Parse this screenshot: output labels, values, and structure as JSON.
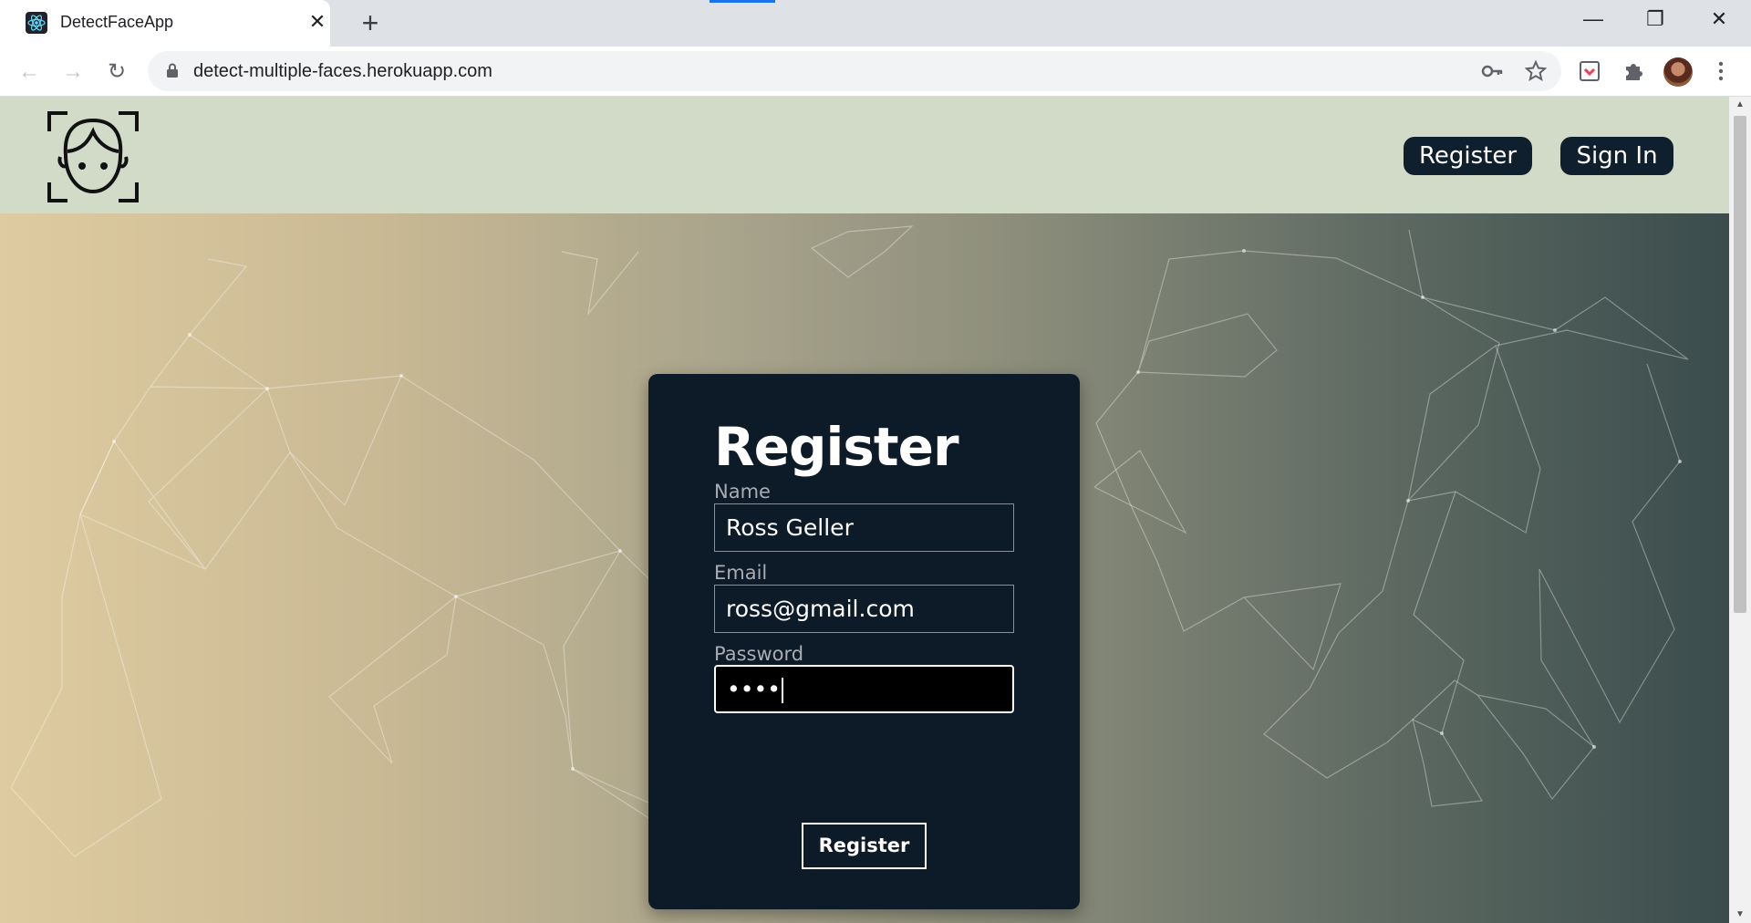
{
  "browser": {
    "tab_title": "DetectFaceApp",
    "tab_close": "✕",
    "new_tab": "+",
    "url": "detect-multiple-faces.herokuapp.com",
    "window_buttons": {
      "minimize": "—",
      "restore": "❐",
      "close": "✕"
    },
    "nav_icons": {
      "back": "←",
      "forward": "→",
      "reload": "↻"
    },
    "icons": [
      "key-icon",
      "star-icon",
      "pocket-icon",
      "puzzle-icon",
      "avatar",
      "more-icon"
    ]
  },
  "header": {
    "logo": "face-detect-logo",
    "register_label": "Register",
    "signin_label": "Sign In"
  },
  "form": {
    "title": "Register",
    "name_label": "Name",
    "name_value": "Ross Geller",
    "email_label": "Email",
    "email_value": "ross@gmail.com",
    "password_label": "Password",
    "password_value": "••••",
    "submit_label": "Register"
  },
  "colors": {
    "header_bg": "#d1dbc8",
    "card_bg": "#0d1a28",
    "gradient_left": "#dfcba1",
    "gradient_right": "#3a4c4c"
  }
}
